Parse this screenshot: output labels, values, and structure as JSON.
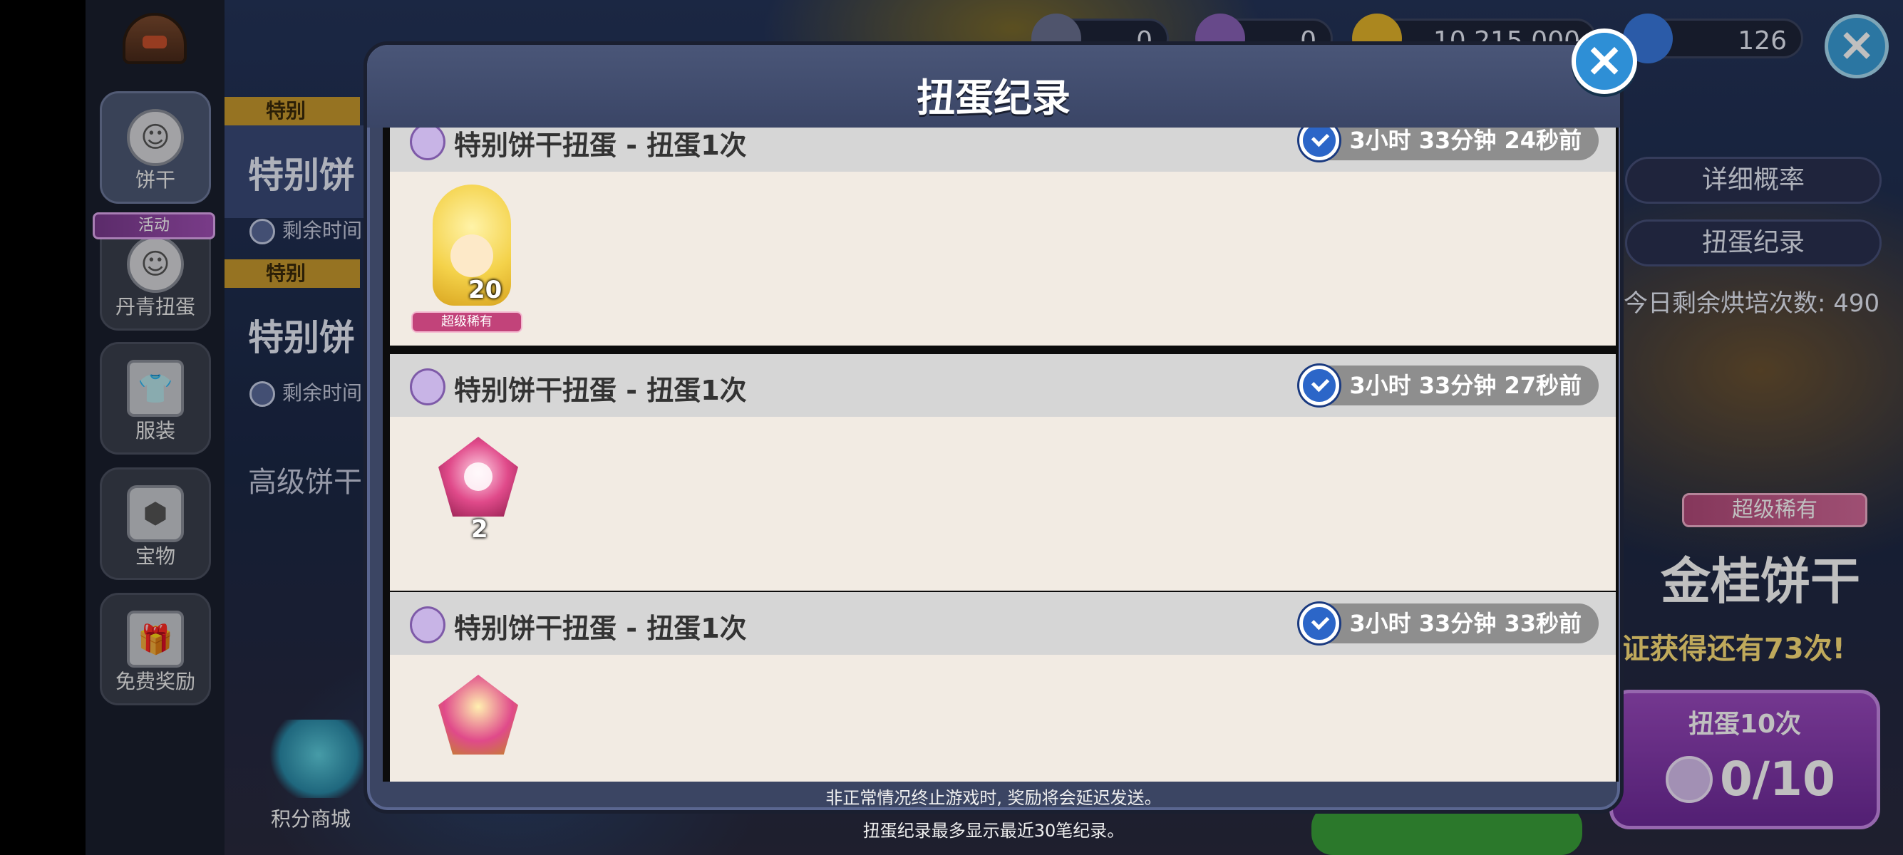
{
  "sidebar": {
    "items": [
      {
        "label": "饼干",
        "icon": "cookie-face-icon"
      },
      {
        "label": "丹青扭蛋",
        "icon": "cookie-face-icon",
        "tag": "活动"
      },
      {
        "label": "服装",
        "icon": "shirt-icon"
      },
      {
        "label": "宝物",
        "icon": "hexagon-icon"
      },
      {
        "label": "免费奖励",
        "icon": "gift-icon"
      }
    ],
    "shop_label": "积分商城"
  },
  "banners": [
    {
      "tag": "特别",
      "title": "特别饼",
      "sub": "剩余时间"
    },
    {
      "tag": "特别",
      "title": "特别饼",
      "sub": "剩余时间"
    }
  ],
  "banner_advanced": "高级饼干",
  "resources": {
    "res1": "0",
    "res2": "0",
    "coins": "10,215,000",
    "gems": "126"
  },
  "right_panel": {
    "detail_rates": "详细概率",
    "gacha_record": "扭蛋纪录",
    "daily_remaining": "今日剩余烘培次数: 490",
    "rarity": "超级稀有",
    "cookie_name": "金桂饼干",
    "guarantee": "证获得还有73次!",
    "pull10_title": "扭蛋10次",
    "pull10_count": "0/10"
  },
  "modal": {
    "title": "扭蛋纪录",
    "records": [
      {
        "title": "特别饼干扭蛋 - 扭蛋1次",
        "time": "3小时 33分钟 24秒前",
        "qty": "20",
        "badge": "超级稀有"
      },
      {
        "title": "特别饼干扭蛋 - 扭蛋1次",
        "time": "3小时 33分钟 27秒前",
        "qty": "2"
      },
      {
        "title": "特别饼干扭蛋 - 扭蛋1次",
        "time": "3小时 33分钟 33秒前"
      }
    ],
    "note1": "非正常情况终止游戏时, 奖励将会延迟发送。",
    "note2": "扭蛋纪录最多显示最近30笔纪录。"
  },
  "colors": {
    "modal_bg": "#3b4563",
    "record_bg": "#f2ebe3",
    "record_header": "#d6d6d6",
    "close_blue": "#2e8fd6",
    "rare_pink": "#c2437a",
    "pull_purple": "#9b4ac0"
  }
}
